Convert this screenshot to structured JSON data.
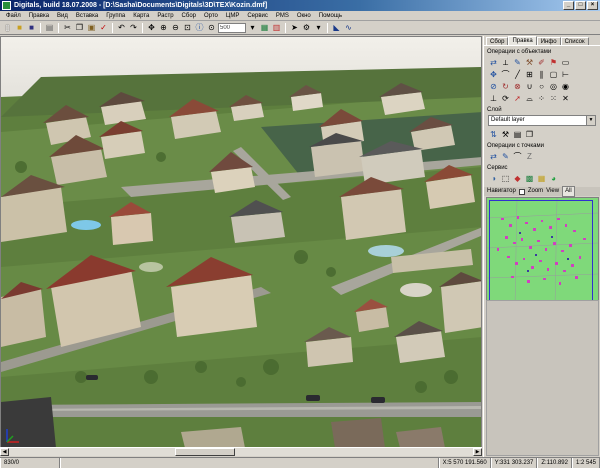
{
  "window": {
    "title": "Digitals, build 18.07.2008 - [D:\\Sasha\\Documents\\Digitals\\3D\\TEX\\Kozin.dmf]",
    "controls": [
      "_",
      "□",
      "×"
    ]
  },
  "menu": {
    "items": [
      "Файл",
      "Правка",
      "Вид",
      "Вставка",
      "Группа",
      "Карта",
      "Растр",
      "Сбор",
      "Орто",
      "ЦМР",
      "Сервис",
      "РМS",
      "Окно",
      "Помощь"
    ]
  },
  "toolbar": {
    "zoom_value": "500",
    "icons": [
      "new-file-icon",
      "open-folder-icon",
      "save-icon",
      "print-icon",
      "cut-icon",
      "copy-icon",
      "paste-icon",
      "check-icon",
      "undo-icon",
      "redo-icon",
      "pan-icon",
      "zoom-in-icon",
      "zoom-out-icon",
      "zoom-window-icon",
      "info-icon"
    ]
  },
  "panel": {
    "tabs": [
      "Сбор",
      "Правка",
      "Инфо",
      "Список"
    ],
    "active_tab": "Правка",
    "objects_label": "Операции с объектами",
    "layer_label": "Слой",
    "layer_value": "Default layer",
    "points_label": "Операции с точками",
    "service_label": "Сервис",
    "navigator": {
      "label": "Навигатор",
      "zoom_label": "Zoom",
      "view_label": "View",
      "all_label": "All"
    }
  },
  "statusbar": {
    "scale": "830/0",
    "x": "X:5 570 191.560",
    "y": "Y:331 303.237",
    "z": "Z:110.892",
    "ratio": "1:2 545"
  },
  "colors": {
    "title_gradient_start": "#0a246a",
    "title_gradient_end": "#a6caf0",
    "chrome": "#d4d0c8",
    "navigator_bg": "#7fd97a"
  }
}
